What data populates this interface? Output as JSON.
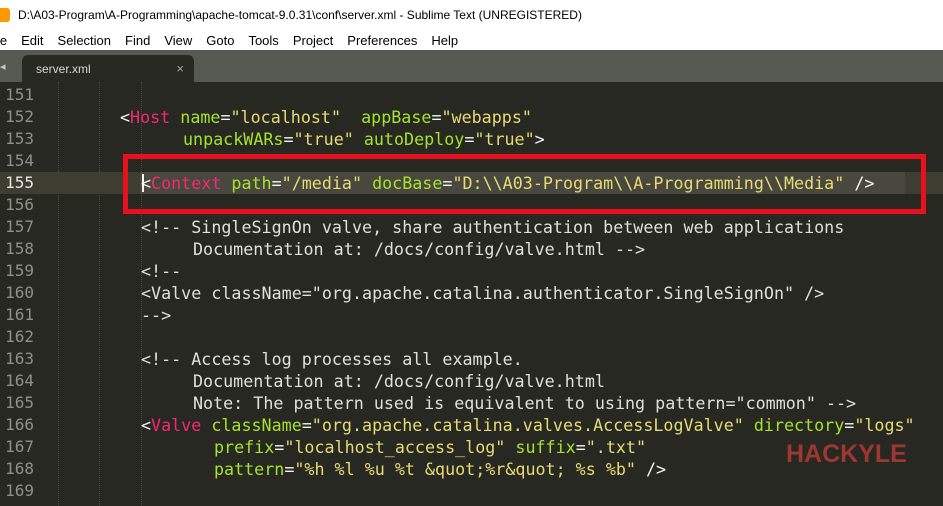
{
  "window": {
    "title": "D:\\A03-Program\\A-Programming\\apache-tomcat-9.0.31\\conf\\server.xml - Sublime Text (UNREGISTERED)"
  },
  "menu": [
    "le",
    "Edit",
    "Selection",
    "Find",
    "View",
    "Goto",
    "Tools",
    "Project",
    "Preferences",
    "Help"
  ],
  "tabs": [
    {
      "label": "server.xml",
      "close": "×"
    }
  ],
  "editor": {
    "current_line": 155,
    "lines": [
      {
        "n": "151",
        "indent": "",
        "tokens": []
      },
      {
        "n": "152",
        "tokens": [
          {
            "c": "t-punc",
            "t": "<"
          },
          {
            "c": "t-tag",
            "t": "Host"
          },
          {
            "c": "t-punc",
            "t": " "
          },
          {
            "c": "t-attr",
            "t": "name"
          },
          {
            "c": "t-punc",
            "t": "="
          },
          {
            "c": "t-str",
            "t": "\"localhost\""
          },
          {
            "c": "t-punc",
            "t": "  "
          },
          {
            "c": "t-attr",
            "t": "appBase"
          },
          {
            "c": "t-punc",
            "t": "="
          },
          {
            "c": "t-str",
            "t": "\"webapps\""
          }
        ],
        "offset": 120
      },
      {
        "n": "153",
        "tokens": [
          {
            "c": "t-attr",
            "t": "unpackWARs"
          },
          {
            "c": "t-punc",
            "t": "="
          },
          {
            "c": "t-str",
            "t": "\"true\""
          },
          {
            "c": "t-punc",
            "t": " "
          },
          {
            "c": "t-attr",
            "t": "autoDeploy"
          },
          {
            "c": "t-punc",
            "t": "="
          },
          {
            "c": "t-str",
            "t": "\"true\""
          },
          {
            "c": "t-punc",
            "t": ">"
          }
        ],
        "offset": 183
      },
      {
        "n": "154",
        "tokens": []
      },
      {
        "n": "155",
        "tokens": [
          {
            "c": "t-punc",
            "t": "<"
          },
          {
            "c": "t-tag",
            "t": "Context"
          },
          {
            "c": "t-punc",
            "t": " "
          },
          {
            "c": "t-attr",
            "t": "path"
          },
          {
            "c": "t-punc",
            "t": "="
          },
          {
            "c": "t-str",
            "t": "\"/media\""
          },
          {
            "c": "t-punc",
            "t": " "
          },
          {
            "c": "t-attr",
            "t": "docBase"
          },
          {
            "c": "t-punc",
            "t": "="
          },
          {
            "c": "t-str",
            "t": "\"D:\\\\A03-Program\\\\A-Programming\\\\Media\""
          },
          {
            "c": "t-punc",
            "t": " />"
          }
        ],
        "offset": 141
      },
      {
        "n": "156",
        "tokens": []
      },
      {
        "n": "157",
        "tokens": [
          {
            "c": "t-cmt-light",
            "t": "<!-- SingleSignOn valve, share authentication between web applications"
          }
        ],
        "offset": 141
      },
      {
        "n": "158",
        "tokens": [
          {
            "c": "t-cmt-light",
            "t": "Documentation at: /docs/config/valve.html -->"
          }
        ],
        "offset": 193
      },
      {
        "n": "159",
        "tokens": [
          {
            "c": "t-cmt-light",
            "t": "<!--"
          }
        ],
        "offset": 141
      },
      {
        "n": "160",
        "tokens": [
          {
            "c": "t-cmt-light",
            "t": "<Valve className=\"org.apache.catalina.authenticator.SingleSignOn\" />"
          }
        ],
        "offset": 141
      },
      {
        "n": "161",
        "tokens": [
          {
            "c": "t-cmt-light",
            "t": "-->"
          }
        ],
        "offset": 141
      },
      {
        "n": "162",
        "tokens": []
      },
      {
        "n": "163",
        "tokens": [
          {
            "c": "t-cmt-light",
            "t": "<!-- Access log processes all example."
          }
        ],
        "offset": 141
      },
      {
        "n": "164",
        "tokens": [
          {
            "c": "t-cmt-light",
            "t": "Documentation at: /docs/config/valve.html"
          }
        ],
        "offset": 193
      },
      {
        "n": "165",
        "tokens": [
          {
            "c": "t-cmt-light",
            "t": "Note: The pattern used is equivalent to using pattern=\"common\" -->"
          }
        ],
        "offset": 193
      },
      {
        "n": "166",
        "tokens": [
          {
            "c": "t-punc",
            "t": "<"
          },
          {
            "c": "t-tag",
            "t": "Valve"
          },
          {
            "c": "t-punc",
            "t": " "
          },
          {
            "c": "t-attr",
            "t": "className"
          },
          {
            "c": "t-punc",
            "t": "="
          },
          {
            "c": "t-str",
            "t": "\"org.apache.catalina.valves.AccessLogValve\""
          },
          {
            "c": "t-punc",
            "t": " "
          },
          {
            "c": "t-attr",
            "t": "directory"
          },
          {
            "c": "t-punc",
            "t": "="
          },
          {
            "c": "t-str",
            "t": "\"logs\""
          }
        ],
        "offset": 141
      },
      {
        "n": "167",
        "tokens": [
          {
            "c": "t-attr",
            "t": "prefix"
          },
          {
            "c": "t-punc",
            "t": "="
          },
          {
            "c": "t-str",
            "t": "\"localhost_access_log\""
          },
          {
            "c": "t-punc",
            "t": " "
          },
          {
            "c": "t-attr",
            "t": "suffix"
          },
          {
            "c": "t-punc",
            "t": "="
          },
          {
            "c": "t-str",
            "t": "\".txt\""
          }
        ],
        "offset": 214
      },
      {
        "n": "168",
        "tokens": [
          {
            "c": "t-attr",
            "t": "pattern"
          },
          {
            "c": "t-punc",
            "t": "="
          },
          {
            "c": "t-str",
            "t": "\"%h %l %u %t &quot;%r&quot; %s %b\""
          },
          {
            "c": "t-punc",
            "t": " />"
          }
        ],
        "offset": 214
      },
      {
        "n": "169",
        "tokens": []
      }
    ]
  },
  "watermark": "HACKYLE",
  "colors": {
    "editor_bg": "#272822",
    "tag": "#f92672",
    "attr": "#a6e22e",
    "string": "#e6db74",
    "annotation": "#e8101e"
  }
}
